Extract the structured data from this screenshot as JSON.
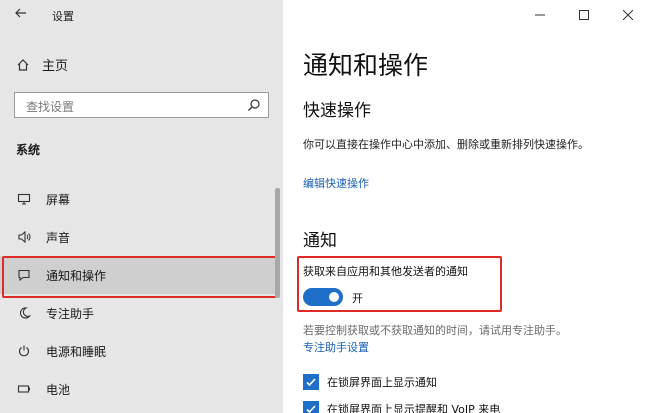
{
  "window": {
    "back_icon": "arrow-left-icon",
    "title": "设置",
    "controls": [
      "minimize-icon",
      "maximize-icon",
      "close-icon"
    ]
  },
  "sidebar": {
    "home_label": "主页",
    "search_placeholder": "查找设置",
    "section_title": "系统",
    "items": [
      {
        "label": "屏幕",
        "icon": "monitor-icon"
      },
      {
        "label": "声音",
        "icon": "speaker-icon"
      },
      {
        "label": "通知和操作",
        "icon": "notification-icon",
        "active": true
      },
      {
        "label": "专注助手",
        "icon": "moon-icon"
      },
      {
        "label": "电源和睡眠",
        "icon": "power-icon"
      },
      {
        "label": "电池",
        "icon": "battery-icon"
      }
    ]
  },
  "main": {
    "page_title": "通知和操作",
    "quick_actions": {
      "heading": "快速操作",
      "description": "你可以直接在操作中心中添加、删除或重新排列快速操作。",
      "edit_link": "编辑快速操作"
    },
    "notifications": {
      "heading": "通知",
      "toggle_label": "获取来自应用和其他发送者的通知",
      "toggle_state": "开",
      "toggle_on": true,
      "hint": "若要控制获取或不获取通知的时间，请试用专注助手。",
      "focus_link": "专注助手设置",
      "checkboxes": [
        {
          "label": "在锁屏界面上显示通知",
          "checked": true
        },
        {
          "label": "在锁屏界面上显示提醒和 VoIP 来电",
          "checked": true
        }
      ]
    }
  },
  "colors": {
    "accent": "#1f6fc9",
    "highlight": "#e02a2a",
    "sidebar_bg": "#e6e6e6"
  }
}
